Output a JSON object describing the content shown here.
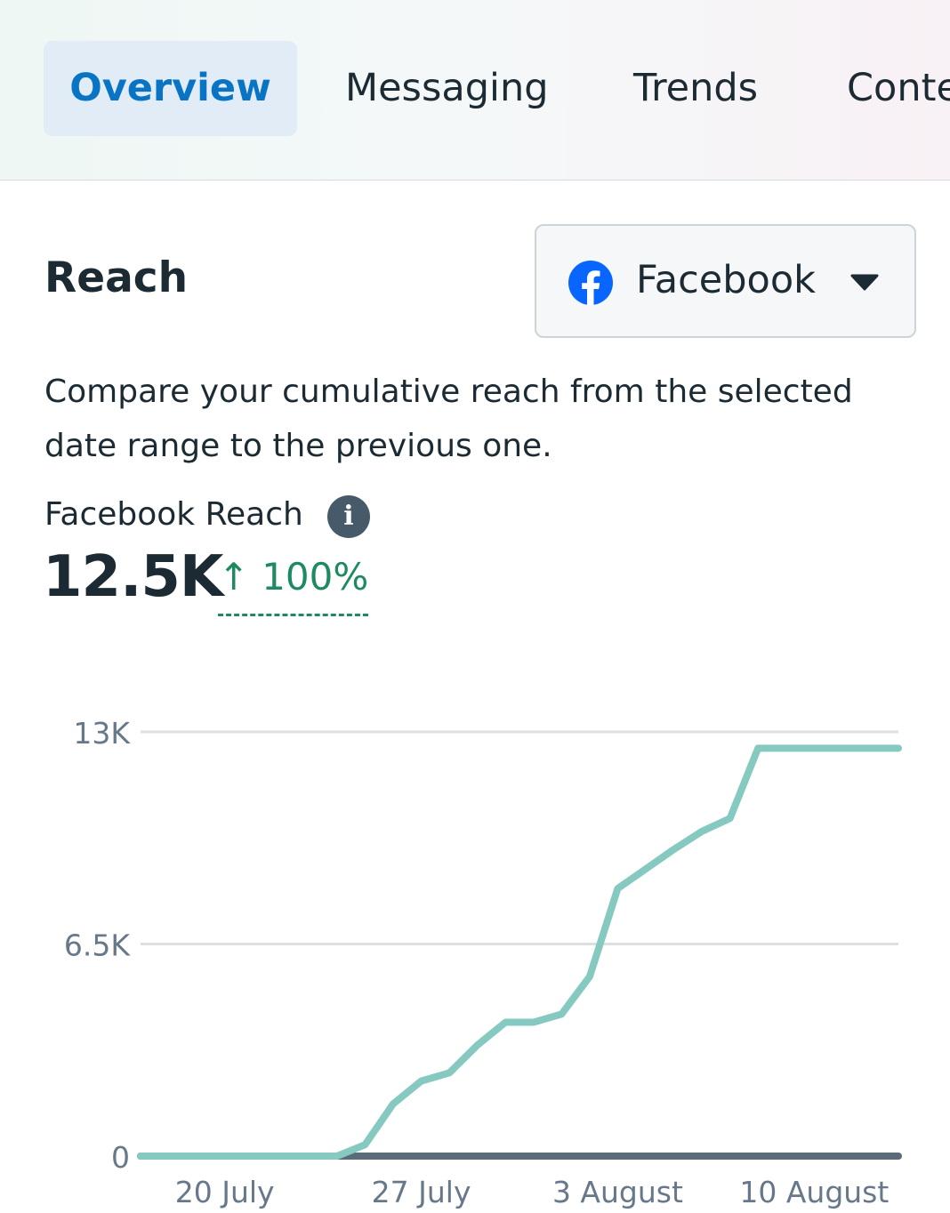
{
  "tabs": [
    {
      "label": "Overview",
      "active": true
    },
    {
      "label": "Messaging",
      "active": false
    },
    {
      "label": "Trends",
      "active": false
    },
    {
      "label": "Content",
      "active": false
    }
  ],
  "section": {
    "title": "Reach",
    "description": "Compare your cumulative reach from the selected date range to the previous one."
  },
  "platform_select": {
    "label": "Facebook",
    "icon": "facebook-icon",
    "caret_icon": "caret-down-icon"
  },
  "metric": {
    "label": "Facebook Reach",
    "info_icon": "info-icon",
    "info_glyph": "i",
    "value": "12.5K",
    "change_arrow": "↑",
    "change": "100%"
  },
  "colors": {
    "accent": "#0a74c4",
    "positive": "#1e8a60",
    "current_series": "#86c9c0",
    "previous_series": "#5b6b79",
    "gridline": "#dcdfe2",
    "text": "#1c2b33"
  },
  "chart_data": {
    "type": "line",
    "y_ticks": [
      {
        "value": 0,
        "label": "0"
      },
      {
        "value": 6500,
        "label": "6.5K"
      },
      {
        "value": 13000,
        "label": "13K"
      }
    ],
    "ylim": [
      0,
      13000
    ],
    "x_ticks": [
      {
        "day": 3,
        "label": "20 July"
      },
      {
        "day": 10,
        "label": "27 July"
      },
      {
        "day": 17,
        "label": "3 August"
      },
      {
        "day": 24,
        "label": "10 August"
      }
    ],
    "xlim": [
      0,
      27
    ],
    "grid": true,
    "series": [
      {
        "role": "current",
        "points": [
          [
            0,
            0
          ],
          [
            1,
            0
          ],
          [
            2,
            0
          ],
          [
            3,
            0
          ],
          [
            4,
            0
          ],
          [
            5,
            0
          ],
          [
            6,
            0
          ],
          [
            7,
            0
          ],
          [
            8,
            350
          ],
          [
            9,
            1600
          ],
          [
            10,
            2300
          ],
          [
            11,
            2550
          ],
          [
            12,
            3400
          ],
          [
            13,
            4100
          ],
          [
            14,
            4100
          ],
          [
            15,
            4350
          ],
          [
            16,
            5500
          ],
          [
            17,
            8200
          ],
          [
            18,
            8800
          ],
          [
            19,
            9400
          ],
          [
            20,
            9950
          ],
          [
            21,
            10350
          ],
          [
            22,
            12500
          ],
          [
            23,
            12500
          ],
          [
            24,
            12500
          ],
          [
            25,
            12500
          ],
          [
            26,
            12500
          ],
          [
            27,
            12500
          ]
        ]
      },
      {
        "role": "previous",
        "points": [
          [
            0,
            0
          ],
          [
            27,
            0
          ]
        ]
      }
    ]
  }
}
